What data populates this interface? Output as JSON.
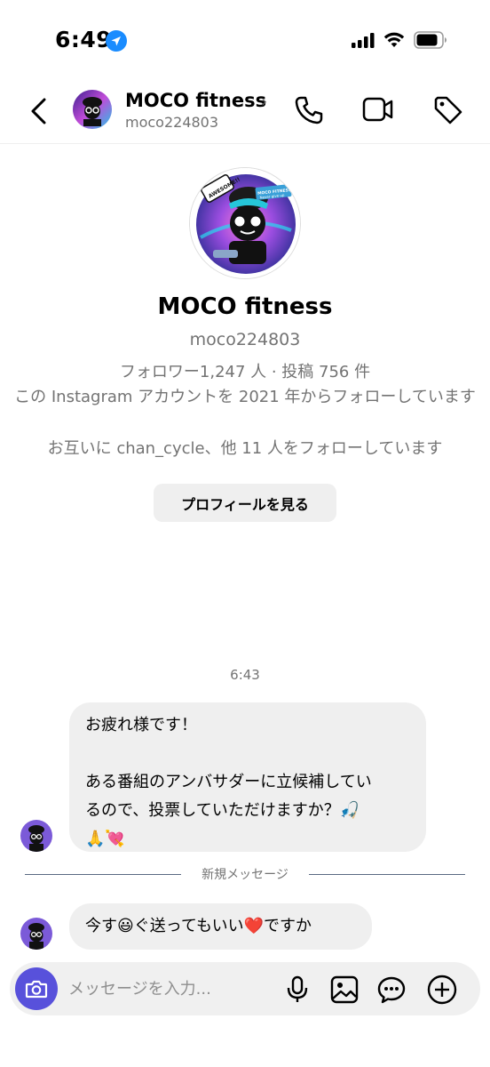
{
  "status_bar": {
    "time": "6:49"
  },
  "header": {
    "name": "MOCO fitness",
    "chevron": "›",
    "handle": "moco224803",
    "icons": [
      "back-icon",
      "call-icon",
      "video-icon",
      "tag-icon"
    ]
  },
  "profile": {
    "name": "MOCO fitness",
    "handle": "moco224803",
    "stats": "フォロワー1,247 人 · 投稿 756 件",
    "follow_since": "この Instagram アカウントを 2021 年からフォローしています",
    "mutual": "お互いに chan_cycle、他 11 人をフォローしています",
    "view_profile_label": "プロフィールを見る",
    "avatar_badge": "AWESOME!!",
    "avatar_banner": "MOCO FITNESS Never give up"
  },
  "messages": {
    "time": "6:43",
    "first": {
      "line1": "お疲れ様です！",
      "line2": "ある番組のアンバサダーに立候補してい",
      "line3": "るので、投票していただけますか？🎣",
      "line4": "🙏💘"
    },
    "divider_label": "新規メッセージ",
    "second": {
      "text": "今す😃ぐ送ってもいい❤️ですか"
    }
  },
  "composer": {
    "placeholder": "メッセージを入力...",
    "icons": [
      "camera-icon",
      "mic-icon",
      "gallery-icon",
      "sticker-icon",
      "plus-icon"
    ]
  },
  "colors": {
    "accent": "#5851db",
    "bubble": "#efefef",
    "secondary_text": "#737373"
  }
}
